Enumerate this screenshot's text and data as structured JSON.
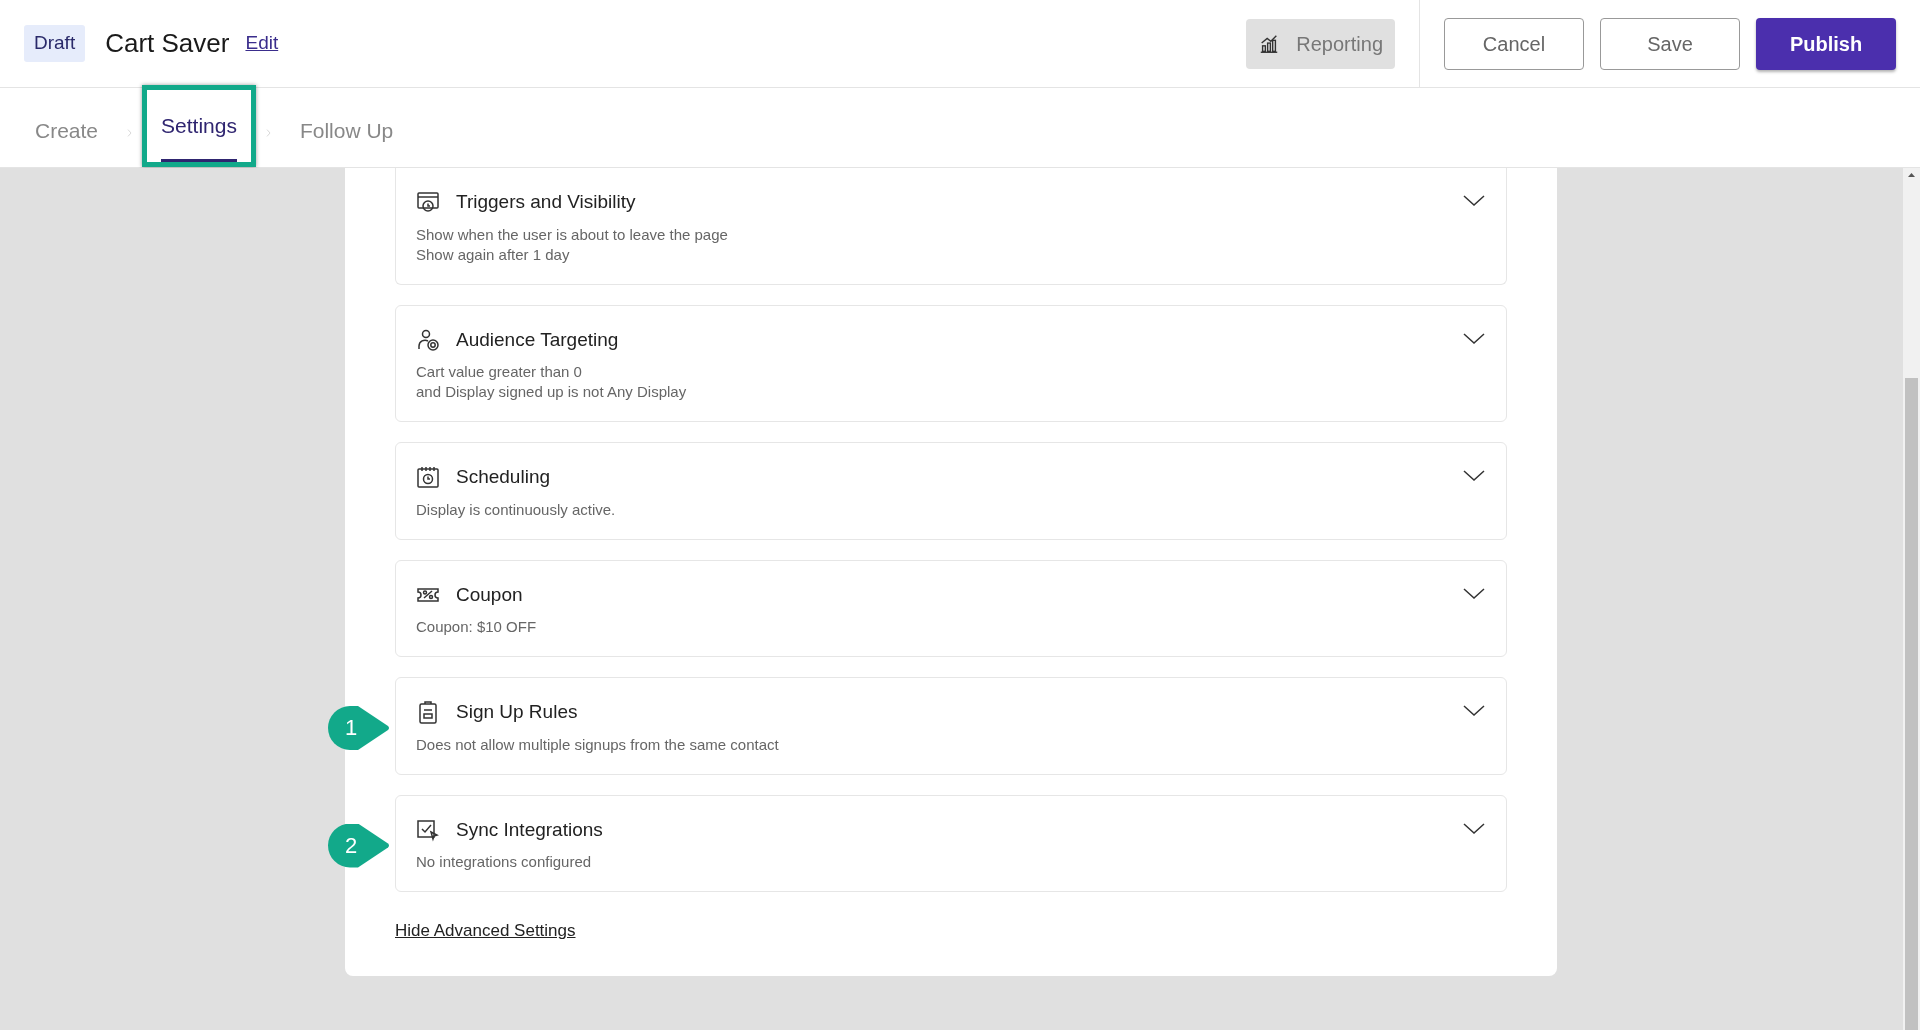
{
  "header": {
    "status_badge": "Draft",
    "title": "Cart Saver",
    "edit_link": "Edit",
    "reporting_button": {
      "label": "Reporting",
      "disabled": true
    },
    "buttons": [
      {
        "label": "Cancel",
        "kind": "outline"
      },
      {
        "label": "Save",
        "kind": "outline"
      },
      {
        "label": "Publish",
        "kind": "primary"
      }
    ]
  },
  "steps": [
    {
      "label": "Create",
      "selected": false,
      "highlighted": false
    },
    {
      "label": "Settings",
      "selected": true,
      "highlighted": true
    },
    {
      "label": "Follow Up",
      "selected": false,
      "highlighted": false
    }
  ],
  "sections": [
    {
      "title": "Triggers and Visibility",
      "lines": [
        "Show when the user is about to leave the page",
        "Show again after 1 day"
      ],
      "expanded": false
    },
    {
      "title": "Audience Targeting",
      "lines": [
        "Cart value greater than 0",
        "and Display signed up is not Any Display"
      ],
      "expanded": false
    },
    {
      "title": "Scheduling",
      "lines": [
        "Display is continuously active."
      ],
      "expanded": false
    },
    {
      "title": "Coupon",
      "lines": [
        "Coupon: $10 OFF"
      ],
      "expanded": false
    },
    {
      "title": "Sign Up Rules",
      "lines": [
        "Does not allow multiple signups from the same contact"
      ],
      "expanded": false,
      "callout": "1"
    },
    {
      "title": "Sync Integrations",
      "lines": [
        "No integrations configured"
      ],
      "expanded": false,
      "callout": "2"
    }
  ],
  "hide_advanced_link": "Hide Advanced Settings"
}
